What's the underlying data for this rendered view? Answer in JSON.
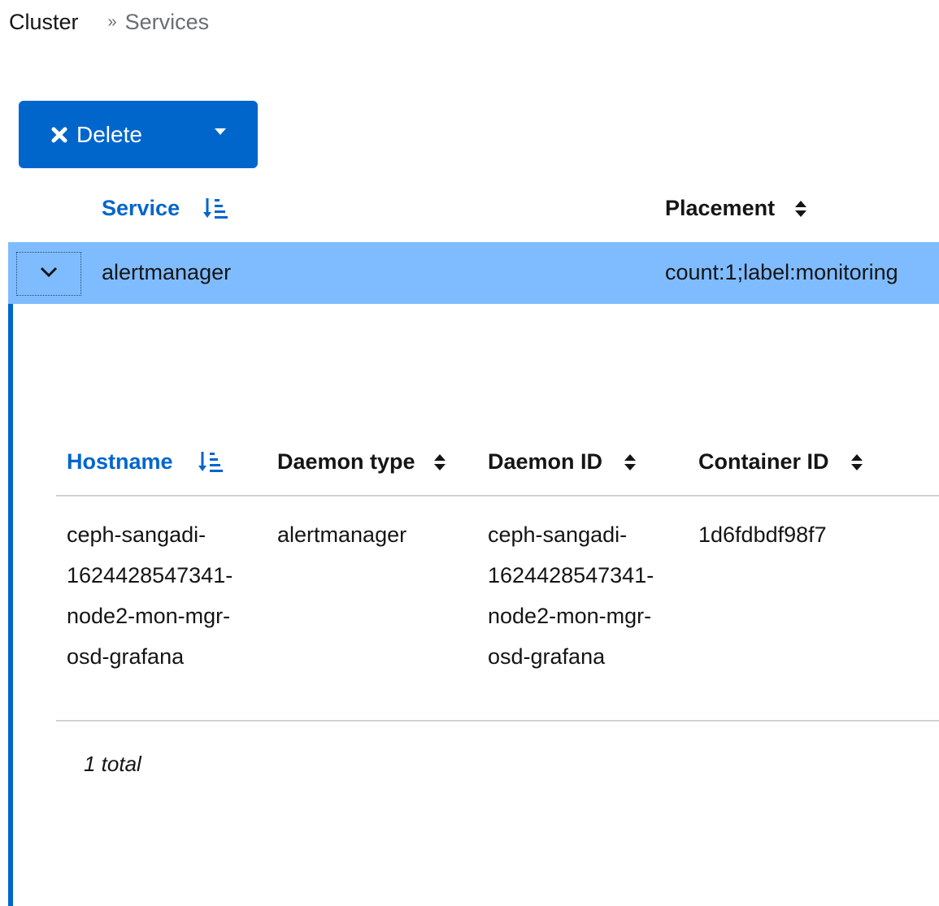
{
  "breadcrumb": {
    "root": "Cluster",
    "separator": "»",
    "current": "Services"
  },
  "toolbar": {
    "delete_label": "Delete",
    "delete_icon": "times-icon",
    "dropdown_icon": "caret-down-icon"
  },
  "services_table": {
    "columns": {
      "service": "Service",
      "placement": "Placement"
    },
    "rows": [
      {
        "service": "alertmanager",
        "placement": "count:1;label:monitoring",
        "expanded": true
      }
    ]
  },
  "daemons_table": {
    "columns": {
      "hostname": "Hostname",
      "daemon_type": "Daemon type",
      "daemon_id": "Daemon ID",
      "container_id": "Container ID"
    },
    "rows": [
      {
        "hostname": "ceph-sangadi-1624428547341-node2-mon-mgr-osd-grafana",
        "daemon_type": "alertmanager",
        "daemon_id": "ceph-sangadi-1624428547341-node2-mon-mgr-osd-grafana",
        "container_id": "1d6fdbdf98f7"
      }
    ],
    "total_label": "1 total"
  },
  "colors": {
    "primary": "#0066cc",
    "selected_row": "#7fbcff",
    "divider": "#d2d2d2"
  }
}
